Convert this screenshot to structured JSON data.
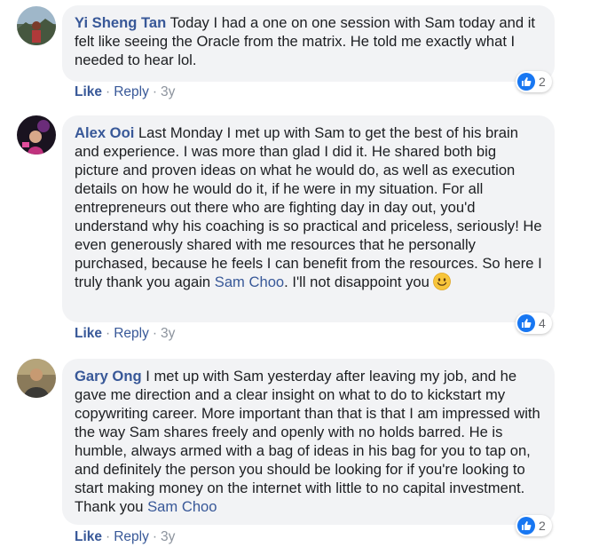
{
  "comments": [
    {
      "author": "Yi Sheng Tan",
      "text": "Today I had a one on one session with Sam today and it felt like seeing the Oracle from the matrix. He told me exactly what I needed to hear lol.",
      "reactions": "2",
      "like_label": "Like",
      "reply_label": "Reply",
      "time": "3y"
    },
    {
      "author": "Alex Ooi",
      "text": "Last Monday I met up with Sam to get the best of his brain and experience. I was more than glad I did it. He shared both big picture and proven ideas on what he would do, as well as execution details on how he would do it, if he were in my situation. For all entrepreneurs out there who are fighting day in day out, you'd understand why his coaching is so practical and priceless, seriously! He even generously shared with me resources that he personally purchased, because he feels I can benefit from the resources. So here I truly thank you again",
      "mention": "Sam Choo",
      "text_after": ". I'll not disappoint you",
      "reactions": "4",
      "like_label": "Like",
      "reply_label": "Reply",
      "time": "3y"
    },
    {
      "author": "Gary Ong",
      "text": "I met up with Sam yesterday after leaving my job, and he gave me direction and a clear insight on what to do to kickstart my copywriting career. More important than that is that I am impressed with the way Sam shares freely and openly with no holds barred. He is humble, always armed with a bag of ideas in his bag for you to tap on, and definitely the person you should be looking for if you're looking to start making money on the internet with little to no capital investment. Thank you",
      "mention": "Sam Choo",
      "reactions": "2",
      "like_label": "Like",
      "reply_label": "Reply",
      "time": "3y"
    }
  ],
  "colors": {
    "author": "#385898",
    "bubble": "#f2f3f5",
    "like_badge": "#1877f2",
    "meta": "#8d949e"
  },
  "icons": [
    "avatar",
    "thumbs-up-icon",
    "smiling-emoji-icon"
  ]
}
